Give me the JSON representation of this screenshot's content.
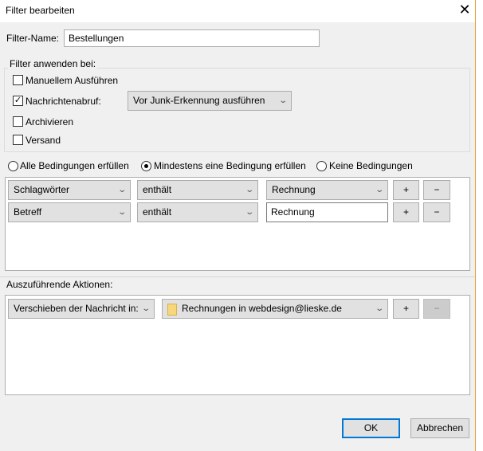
{
  "title": "Filter bearbeiten",
  "filter_name": {
    "label": "Filter-Name:",
    "value": "Bestellungen"
  },
  "apply_group": {
    "legend": "Filter anwenden bei:",
    "items": [
      {
        "label": "Manuellem Ausführen",
        "checked": false
      },
      {
        "label": "Nachrichtenabruf:",
        "checked": true
      },
      {
        "label": "Archivieren",
        "checked": false
      },
      {
        "label": "Versand",
        "checked": false
      }
    ],
    "junk_select": "Vor Junk-Erkennung ausführen"
  },
  "match_mode": {
    "options": [
      "Alle Bedingungen erfüllen",
      "Mindestens eine Bedingung erfüllen",
      "Keine Bedingungen"
    ],
    "selected": 1
  },
  "conditions": [
    {
      "field": "Schlagwörter",
      "operator": "enthält",
      "value": "Rechnung",
      "value_type": "select"
    },
    {
      "field": "Betreff",
      "operator": "enthält",
      "value": "Rechnung",
      "value_type": "input"
    }
  ],
  "actions_label": "Auszuführende Aktionen:",
  "actions": [
    {
      "action": "Verschieben der Nachricht in:",
      "target": "Rechnungen in webdesign@lieske.de"
    }
  ],
  "buttons": {
    "add": "+",
    "remove": "−",
    "ok": "OK",
    "cancel": "Abbrechen",
    "close": "✕"
  },
  "colors": {
    "accent": "#0078d7",
    "window_border": "#e8a33c"
  }
}
